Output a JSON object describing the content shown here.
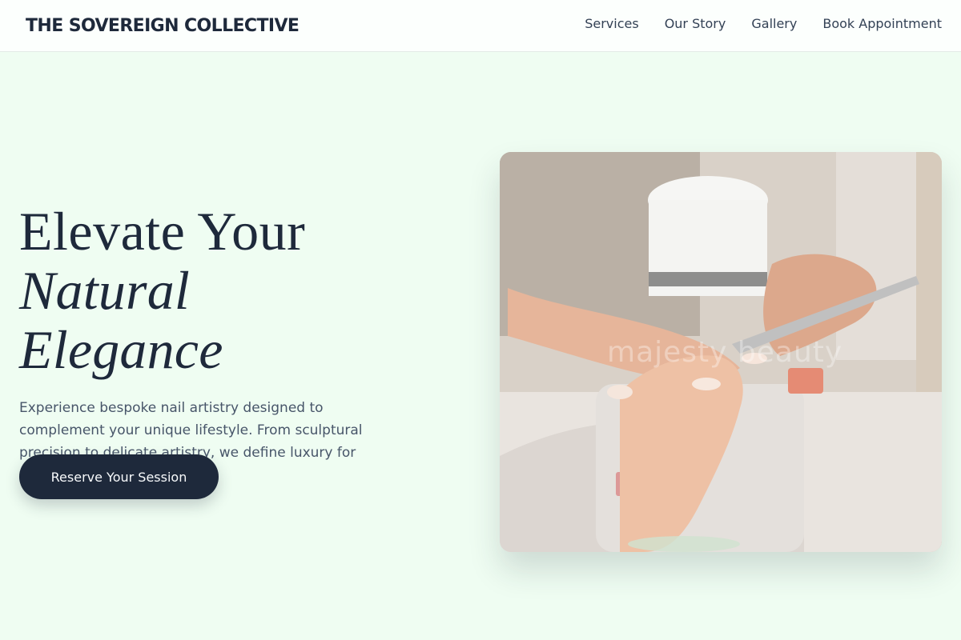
{
  "header": {
    "brand": "THE SOVEREIGN COLLECTIVE",
    "nav": [
      "Services",
      "Our Story",
      "Gallery",
      "Book Appointment"
    ]
  },
  "hero": {
    "headline_line1": "Elevate Your",
    "headline_line2": "Natural Elegance",
    "description": "Experience bespoke nail artistry designed to complement your unique lifestyle. From sculptural precision to delicate artistry, we define luxury for your hands.",
    "cta_label": "Reserve Your Session",
    "image_watermark": "majesty beauty"
  },
  "colors": {
    "background": "#effdf2",
    "primary": "#1e293b",
    "text_muted": "#475569"
  }
}
